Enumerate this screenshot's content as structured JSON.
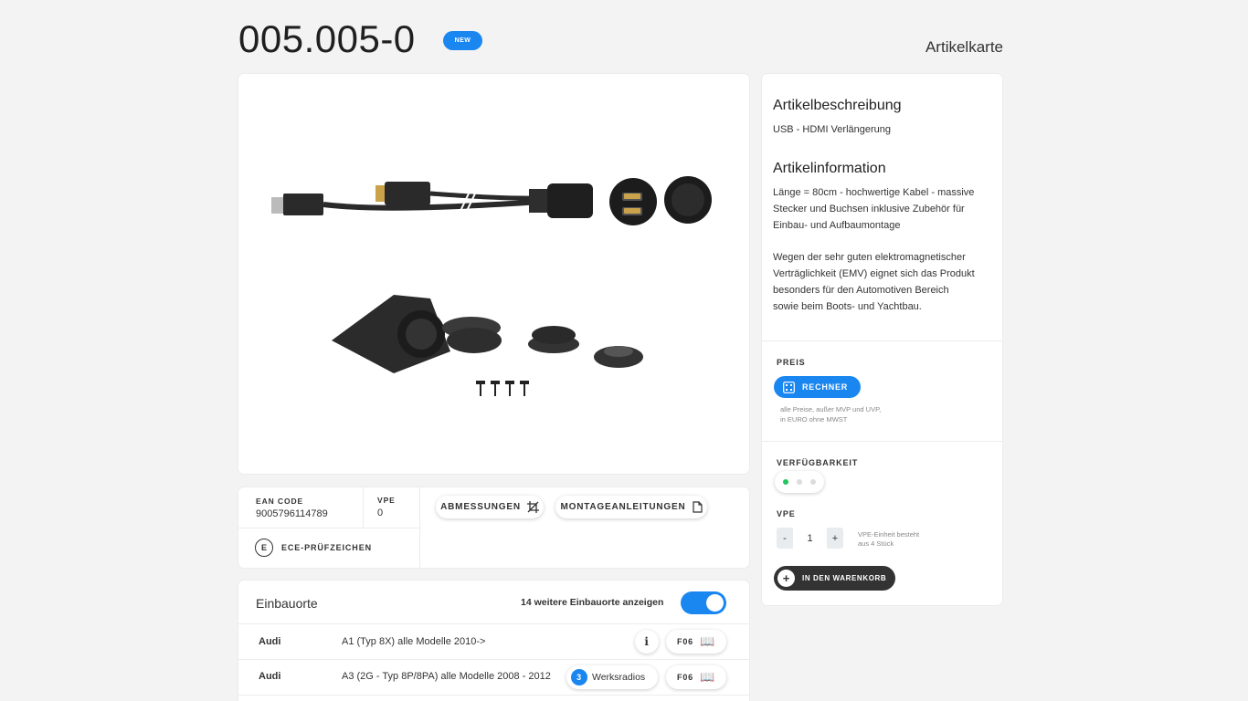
{
  "header": {
    "article_number": "005.005-0",
    "new_badge": "NEW",
    "page_label": "Artikelkarte"
  },
  "details": {
    "ean_label": "EAN CODE",
    "ean_value": "9005796114789",
    "vpe_label": "VPE",
    "vpe_value": "0",
    "ece_label": "ECE-PRÜFZEICHEN",
    "dimensions_button": "ABMESSUNGEN",
    "instructions_button": "MONTAGEANLEITUNGEN"
  },
  "description": {
    "title": "Artikelbeschreibung",
    "text": "USB - HDMI Verlängerung",
    "info_title": "Artikelinformation",
    "info_line1": "Länge = 80cm - hochwertige Kabel - massive",
    "info_line2": "Stecker und Buchsen inklusive Zubehör für",
    "info_line3": "Einbau- und Aufbaumontage",
    "info_line4": "Wegen der sehr guten elektromagnetischer",
    "info_line5": "Verträglichkeit (EMV) eignet sich das Produkt",
    "info_line6": "besonders für den Automotiven Bereich",
    "info_line7": "sowie beim Boots- und Yachtbau."
  },
  "price": {
    "label": "PREIS",
    "calculator_button": "RECHNER",
    "note_line1": "alle Preise, außer MVP und UVP,",
    "note_line2": "in EURO ohne MWST"
  },
  "availability": {
    "label": "VERFÜGBARKEIT",
    "level": "1 of 3",
    "color_active": "#22c55e",
    "color_inactive": "#dcdcdc"
  },
  "vpe": {
    "label": "VPE",
    "minus": "-",
    "quantity": "1",
    "plus": "+",
    "note_line1": "VPE-Einheit besteht",
    "note_line2": "aus 4 Stück"
  },
  "cart": {
    "plus": "+",
    "button": "IN DEN WARENKORB"
  },
  "installation": {
    "title": "Einbauorte",
    "toggle_label": "14 weitere Einbauorte anzeigen",
    "toggle_on": true,
    "rows": [
      {
        "brand": "Audi",
        "model": "A1 (Typ 8X) alle Modelle 2010->",
        "info": "i",
        "code": "F06"
      },
      {
        "brand": "Audi",
        "model": "A3 (2G - Typ 8P/8PA) alle Modelle 2008 - 2012",
        "radio_count": "3",
        "radio_label": "Werksradios",
        "code": "F06"
      }
    ]
  },
  "colors": {
    "accent": "#1a86f0",
    "dark": "#333333",
    "background": "#f3f3f3"
  }
}
